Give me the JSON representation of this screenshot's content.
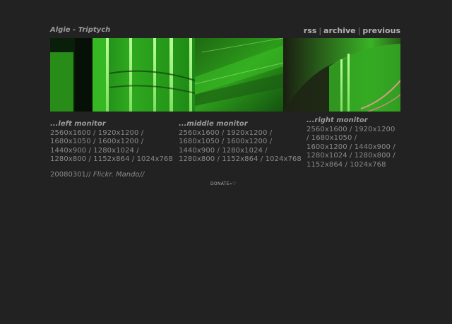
{
  "header": {
    "title": "Algie - Triptych",
    "nav": [
      "rss",
      "archive",
      "previous"
    ]
  },
  "monitors": [
    {
      "heading": "...left monitor",
      "resolutions": [
        "2560x1600",
        "1920x1200",
        "1680x1050",
        "1600x1200",
        "1440x900",
        "1280x1024",
        "1280x800",
        "1152x864",
        "1024x768"
      ]
    },
    {
      "heading": "...middle monitor",
      "resolutions": [
        "2560x1600",
        "1920x1200",
        "1680x1050",
        "1600x1200",
        "1440x900",
        "1280x1024",
        "1280x800",
        "1152x864",
        "1024x768"
      ]
    },
    {
      "heading": "...right monitor",
      "resolutions": [
        "2560x1600",
        "1920x1200",
        "1680x1050",
        "1600x1200",
        "1440x900",
        "1280x1024",
        "1280x800",
        "1152x864",
        "1024x768"
      ]
    }
  ],
  "footer": {
    "date": "20080301//",
    "credit": "Flickr. Mando//"
  },
  "donate": "DONATE»♡"
}
